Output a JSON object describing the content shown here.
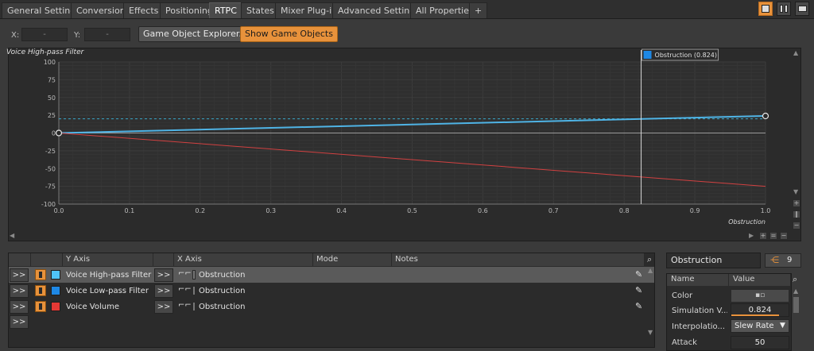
{
  "tabs": [
    {
      "label": "General Settings",
      "active": false
    },
    {
      "label": "Conversion",
      "active": false
    },
    {
      "label": "Effects",
      "active": false
    },
    {
      "label": "Positioning",
      "active": false
    },
    {
      "label": "RTPC",
      "active": true
    },
    {
      "label": "States",
      "active": false
    },
    {
      "label": "Mixer Plug-in",
      "active": false
    },
    {
      "label": "Advanced Settings",
      "active": false
    },
    {
      "label": "All Properties",
      "active": false
    },
    {
      "label": "+",
      "active": false
    }
  ],
  "toolbar": {
    "x_label": "X:",
    "x_value": "-",
    "y_label": "Y:",
    "y_value": "-",
    "game_object_explorer": "Game Object Explorer...",
    "show_game_objects": "Show Game Objects"
  },
  "graph": {
    "title": "Voice High-pass Filter",
    "x_axis_name": "Obstruction",
    "cursor_label": "Obstruction (0.824)",
    "cursor_value": 0.824,
    "colors": {
      "high_pass": "#4fb4e6",
      "low_pass": "#1e78d2",
      "volume": "#d24141",
      "dashed": "#3aa6c8"
    }
  },
  "chart_data": {
    "type": "line",
    "xlim": [
      0,
      1
    ],
    "ylim": [
      -100,
      100
    ],
    "x_ticks": [
      "0.0",
      "0.1",
      "0.2",
      "0.3",
      "0.4",
      "0.5",
      "0.6",
      "0.7",
      "0.8",
      "0.9",
      "1.0"
    ],
    "y_ticks": [
      "100",
      "75",
      "50",
      "25",
      "0",
      "-25",
      "-50",
      "-75",
      "-100"
    ],
    "xlabel": "Obstruction",
    "ylabel": "Voice High-pass Filter",
    "series": [
      {
        "name": "Voice High-pass Filter",
        "x": [
          0,
          1
        ],
        "y": [
          0,
          24
        ]
      },
      {
        "name": "Voice Volume",
        "x": [
          0,
          1
        ],
        "y": [
          0,
          -75
        ]
      }
    ],
    "reference_line_y": 20,
    "cursor_x": 0.824
  },
  "list": {
    "headers": {
      "y_axis": "Y Axis",
      "x_axis": "X Axis",
      "mode": "Mode",
      "notes": "Notes"
    },
    "expander": ">>",
    "rows": [
      {
        "y_axis": "Voice High-pass Filter",
        "x_axis": "Obstruction",
        "color": "#4fc3f7",
        "selected": true
      },
      {
        "y_axis": "Voice Low-pass Filter",
        "x_axis": "Obstruction",
        "color": "#1e88e5",
        "selected": false
      },
      {
        "y_axis": "Voice Volume",
        "x_axis": "Obstruction",
        "color": "#e53935",
        "selected": false
      }
    ]
  },
  "properties": {
    "name": "Obstruction",
    "ref_count": "9",
    "header_name": "Name",
    "header_value": "Value",
    "rows": [
      {
        "name": "Color",
        "value": ""
      },
      {
        "name": "Simulation V...",
        "value": "0.824"
      },
      {
        "name": "Interpolatio...",
        "value": "Slew Rate"
      },
      {
        "name": "Attack",
        "value": "50"
      }
    ]
  }
}
